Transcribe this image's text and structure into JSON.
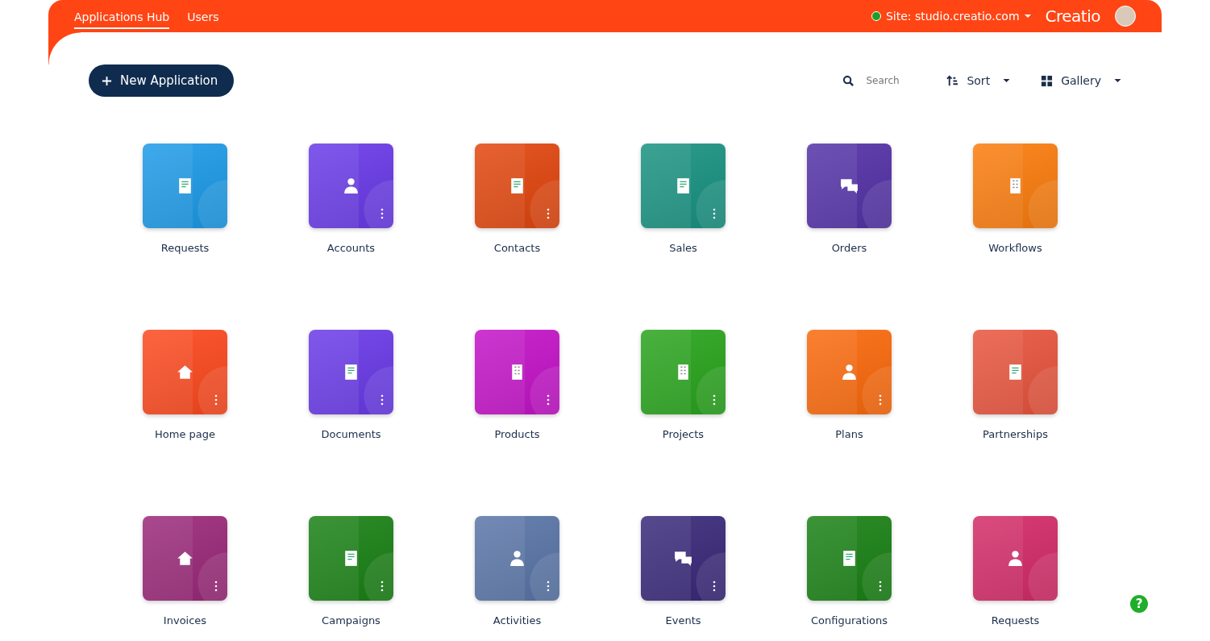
{
  "header": {
    "tabs": [
      {
        "label": "Applications Hub",
        "selected": true
      },
      {
        "label": "Users",
        "selected": false
      }
    ],
    "site": {
      "label": "Site: studio.creatio.com",
      "online": true
    },
    "logo": "Creatio"
  },
  "toolbar": {
    "new_button": "New Application",
    "search": {
      "placeholder": "Search"
    },
    "sort": "Sort",
    "view": "Gallery"
  },
  "apps": [
    {
      "name": "Requests",
      "color": "#1e9be8",
      "menu": false
    },
    {
      "name": "Accounts",
      "color": "#6a3be8",
      "menu": true
    },
    {
      "name": "Contacts",
      "color": "#e2470f",
      "menu": true
    },
    {
      "name": "Sales",
      "color": "#1a9382",
      "menu": true
    },
    {
      "name": "Orders",
      "color": "#5533a8",
      "menu": false
    },
    {
      "name": "Workflows",
      "color": "#fb7d0e",
      "menu": false
    },
    {
      "name": "Home page",
      "color": "#fc4a1f",
      "menu": true
    },
    {
      "name": "Documents",
      "color": "#6a3be8",
      "menu": true
    },
    {
      "name": "Products",
      "color": "#c414c8",
      "menu": true
    },
    {
      "name": "Projects",
      "color": "#2aa51e",
      "menu": true
    },
    {
      "name": "Plans",
      "color": "#fb6a0d",
      "menu": true
    },
    {
      "name": "Partnerships",
      "color": "#e8553e",
      "menu": false
    },
    {
      "name": "Invoices",
      "color": "#9b2a7a",
      "menu": true
    },
    {
      "name": "Campaigns",
      "color": "#1b8216",
      "menu": true
    },
    {
      "name": "Activities",
      "color": "#5a76a8",
      "menu": true
    },
    {
      "name": "Events",
      "color": "#3a2a7a",
      "menu": true
    },
    {
      "name": "Configurations",
      "color": "#1b8216",
      "menu": true
    },
    {
      "name": "Requests",
      "color": "#d42c68",
      "menu": false
    }
  ],
  "help": "?"
}
